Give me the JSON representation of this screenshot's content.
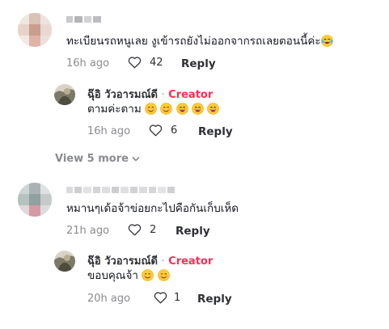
{
  "comments": [
    {
      "text": "ทะเบียนรถหนูเลย งูเข้ารถยังไม่ออกจากรถเลยตอนนี้ค่ะ",
      "time": "16h ago",
      "likes": "42",
      "reply_label": "Reply",
      "emojis": [
        "laughing-tears"
      ]
    },
    {
      "text": "หมานๆเด้อจ้าข่อยกะไปคือกันเก็บเห็ด",
      "time": "21h ago",
      "likes": "2",
      "reply_label": "Reply"
    }
  ],
  "replies": [
    {
      "author": "ฉุ๊อิ วัวอารมณ์ดี",
      "separator": "·",
      "badge": "Creator",
      "text": "ตามค่ะตาม",
      "time": "16h ago",
      "likes": "6",
      "reply_label": "Reply",
      "emojis": [
        "smile",
        "smile",
        "grin",
        "grin",
        "grin"
      ]
    },
    {
      "author": "ฉุ๊อิ วัวอารมณ์ดี",
      "separator": "·",
      "badge": "Creator",
      "text": "ขอบคุณจ้า",
      "time": "20h ago",
      "likes": "1",
      "reply_label": "Reply",
      "emojis": [
        "smile",
        "smile"
      ]
    }
  ],
  "view_more": {
    "label": "View 5 more"
  },
  "icons": {
    "like": "heart-outline-icon",
    "expand": "chevron-down-icon"
  },
  "colors": {
    "creator": "#fe2c55",
    "meta": "#8a8b91",
    "text": "#161823"
  }
}
